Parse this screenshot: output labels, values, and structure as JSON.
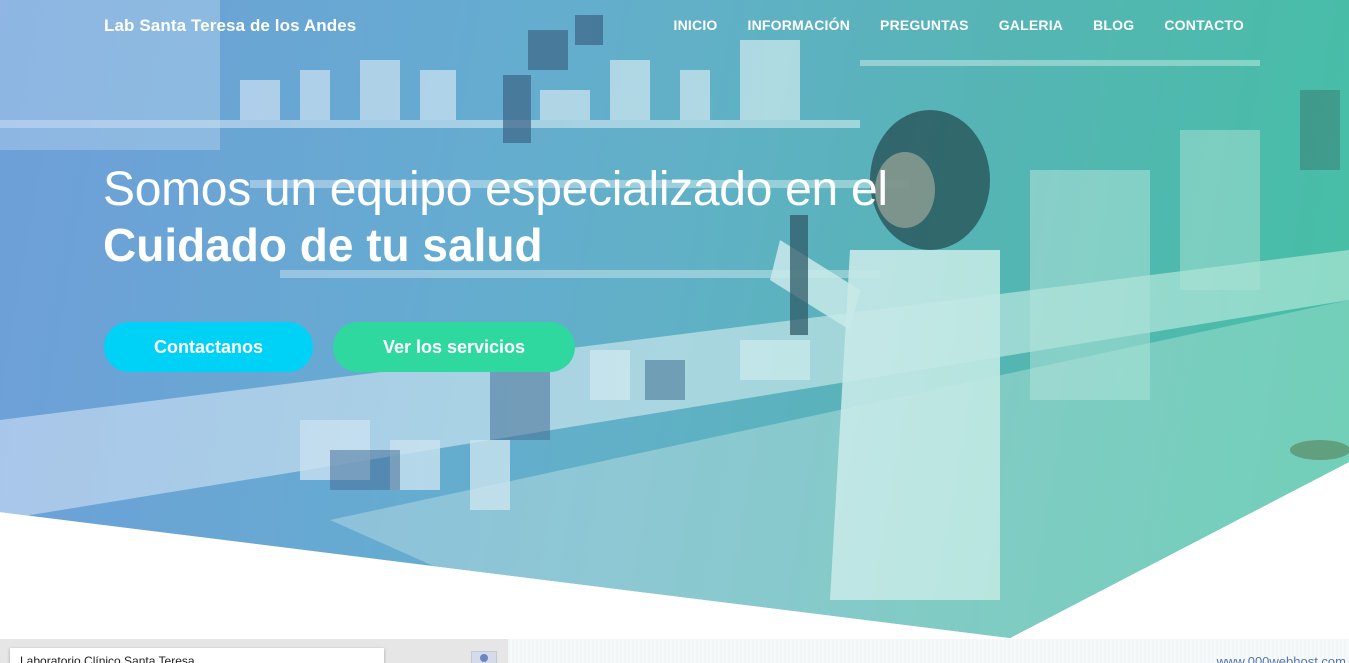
{
  "brand": "Lab Santa Teresa de los Andes",
  "nav": [
    {
      "label": "INICIO"
    },
    {
      "label": "INFORMACIÓN"
    },
    {
      "label": "PREGUNTAS"
    },
    {
      "label": "GALERIA"
    },
    {
      "label": "BLOG"
    },
    {
      "label": "CONTACTO"
    }
  ],
  "hero": {
    "headline_light": "Somos un equipo especializado en el",
    "headline_bold": "Cuidado de tu salud",
    "cta_primary": "Contactanos",
    "cta_secondary": "Ver los servicios"
  },
  "map": {
    "label": "Laboratorio Clínico Santa Teresa..."
  },
  "footer": {
    "watermark": "www.000webhost.com"
  },
  "colors": {
    "cta_primary": "#00d2f7",
    "cta_secondary": "#2fd89e",
    "gradient_left": "#6f9fd6",
    "gradient_right": "#3fc99a"
  }
}
